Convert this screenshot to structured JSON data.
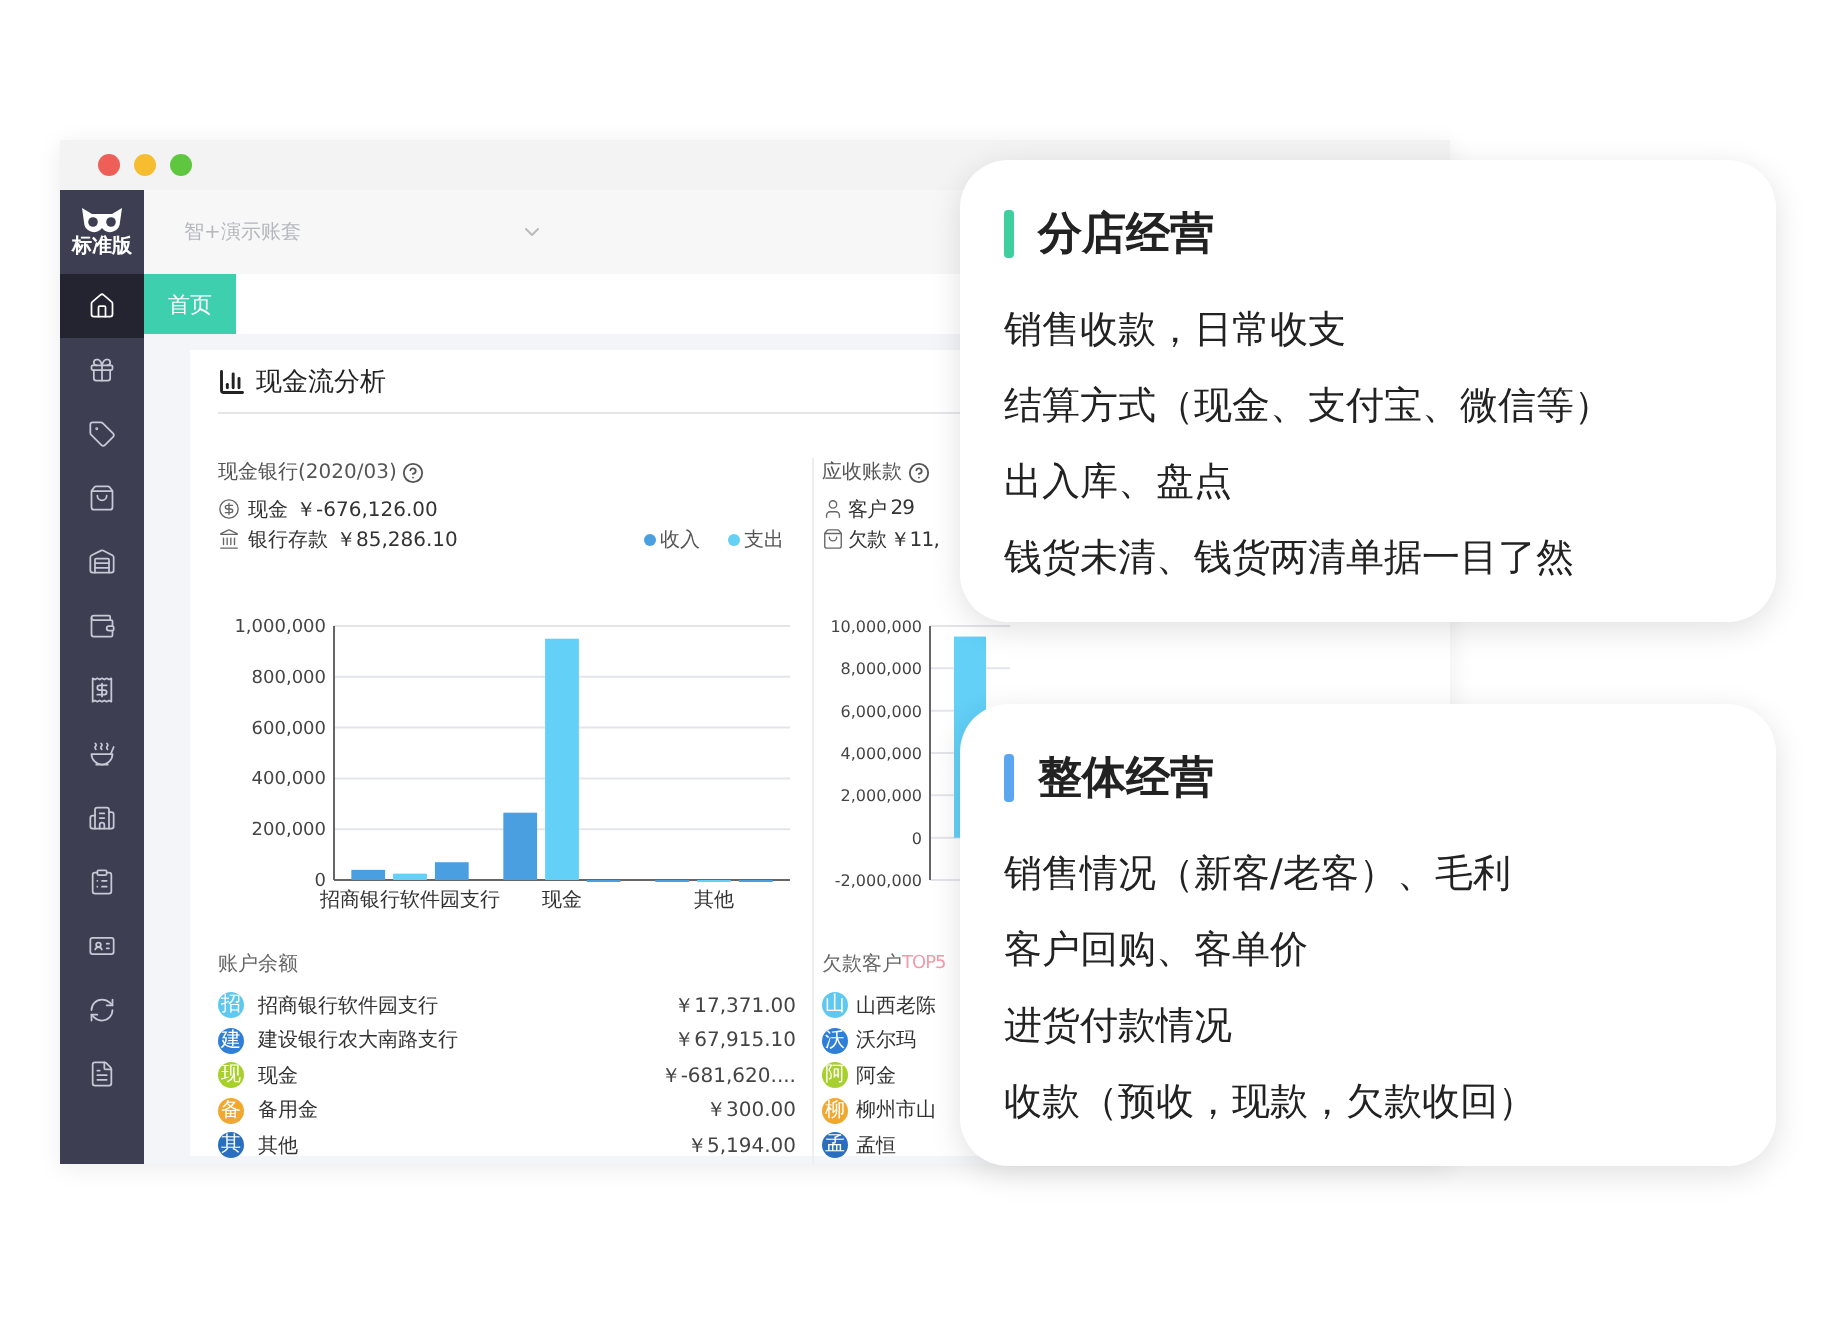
{
  "window": {
    "traffic_lights": [
      {
        "color": "#ee5f57"
      },
      {
        "color": "#f5bd2f"
      },
      {
        "color": "#5fc73f"
      }
    ]
  },
  "logo": {
    "label": "标准版"
  },
  "sidebar": {
    "items": [
      {
        "selected": true
      },
      {
        "selected": false
      },
      {
        "selected": false
      },
      {
        "selected": false
      },
      {
        "selected": false
      },
      {
        "selected": false
      },
      {
        "selected": false
      },
      {
        "selected": false
      },
      {
        "selected": false
      },
      {
        "selected": false
      },
      {
        "selected": false
      },
      {
        "selected": false
      },
      {
        "selected": false
      }
    ]
  },
  "account_select": {
    "placeholder": "智+演示账套"
  },
  "tabs": [
    {
      "label": "首页",
      "selected": true
    }
  ],
  "panel": {
    "title": "现金流分析",
    "cash_bank": {
      "title": "现金银行(2020/03)",
      "lines": [
        {
          "label": "现金",
          "value": "￥-676,126.00"
        },
        {
          "label": "银行存款",
          "value": "￥85,286.10"
        }
      ],
      "chart_data": {
        "type": "bar",
        "grid": true,
        "categories": [
          "招商银行软件园支行",
          "现金",
          "其他"
        ],
        "series": [
          {
            "name": "收入",
            "color": "#4a9fe0",
            "values": [
              40000,
              265000,
              0
            ]
          },
          {
            "name": "支出",
            "color": "#62d0f7",
            "values": [
              25000,
              950000,
              0
            ]
          },
          {
            "color": "#4a9fe0",
            "values": [
              70000,
              0,
              0
            ]
          }
        ],
        "ylim": [
          0,
          1000000
        ],
        "yticks": [
          {
            "value": 0,
            "label": "0"
          },
          {
            "value": 200000,
            "label": "200,000"
          },
          {
            "value": 400000,
            "label": "400,000"
          },
          {
            "value": 600000,
            "label": "600,000"
          },
          {
            "value": 800000,
            "label": "800,000"
          },
          {
            "value": 1000000,
            "label": "1,000,000"
          }
        ]
      },
      "list_title": "账户余额",
      "accounts": [
        {
          "badge": "招",
          "color": "#5ec8f0",
          "name": "招商银行软件园支行",
          "amount": "￥17,371.00"
        },
        {
          "badge": "建",
          "color": "#2f7fd6",
          "name": "建设银行农大南路支行",
          "amount": "￥67,915.10"
        },
        {
          "badge": "现",
          "color": "#a7cf2e",
          "name": "现金",
          "amount": "￥-681,620...."
        },
        {
          "badge": "备",
          "color": "#f0a830",
          "name": "备用金",
          "amount": "￥300.00"
        },
        {
          "badge": "其",
          "color": "#2a6fbf",
          "name": "其他",
          "amount": "￥5,194.00"
        }
      ]
    },
    "receivables": {
      "title": "应收账款",
      "lines": [
        {
          "label": "客户",
          "value": "29"
        },
        {
          "label": "欠款",
          "value": "￥11,"
        }
      ],
      "chart_data": {
        "type": "bar",
        "grid": true,
        "series": [
          {
            "color": "#62d0f7",
            "values": [
              9500000
            ]
          }
        ],
        "ylim": [
          -2000000,
          10000000
        ],
        "yticks": [
          {
            "value": -2000000,
            "label": "-2,000,000"
          },
          {
            "value": 0,
            "label": "0"
          },
          {
            "value": 2000000,
            "label": "2,000,000"
          },
          {
            "value": 4000000,
            "label": "4,000,000"
          },
          {
            "value": 6000000,
            "label": "6,000,000"
          },
          {
            "value": 8000000,
            "label": "8,000,000"
          },
          {
            "value": 10000000,
            "label": "10,000,000"
          }
        ]
      },
      "list_title": "欠款客户",
      "list_title_accent": "TOP5",
      "customers": [
        {
          "badge": "山",
          "color": "#5ec8f0",
          "name": "山西老陈"
        },
        {
          "badge": "沃",
          "color": "#2f7fd6",
          "name": "沃尔玛"
        },
        {
          "badge": "阿",
          "color": "#a7cf2e",
          "name": "阿金"
        },
        {
          "badge": "柳",
          "color": "#f0a830",
          "name": "柳州市山"
        },
        {
          "badge": "孟",
          "color": "#2a6fbf",
          "name": "孟恒"
        }
      ]
    }
  },
  "callouts": [
    {
      "title": "分店经营",
      "color": "#3ecf9e",
      "lines": [
        "销售收款，日常收支",
        "结算方式（现金、支付宝、微信等）",
        "出入库、盘点",
        "钱货未清、钱货两清单据一目了然"
      ]
    },
    {
      "title": "整体经营",
      "color": "#5aa7f0",
      "lines": [
        "销售情况（新客/老客）、毛利",
        "客户回购、客单价",
        "进货付款情况",
        "收款（预收，现款，欠款收回）"
      ]
    }
  ]
}
